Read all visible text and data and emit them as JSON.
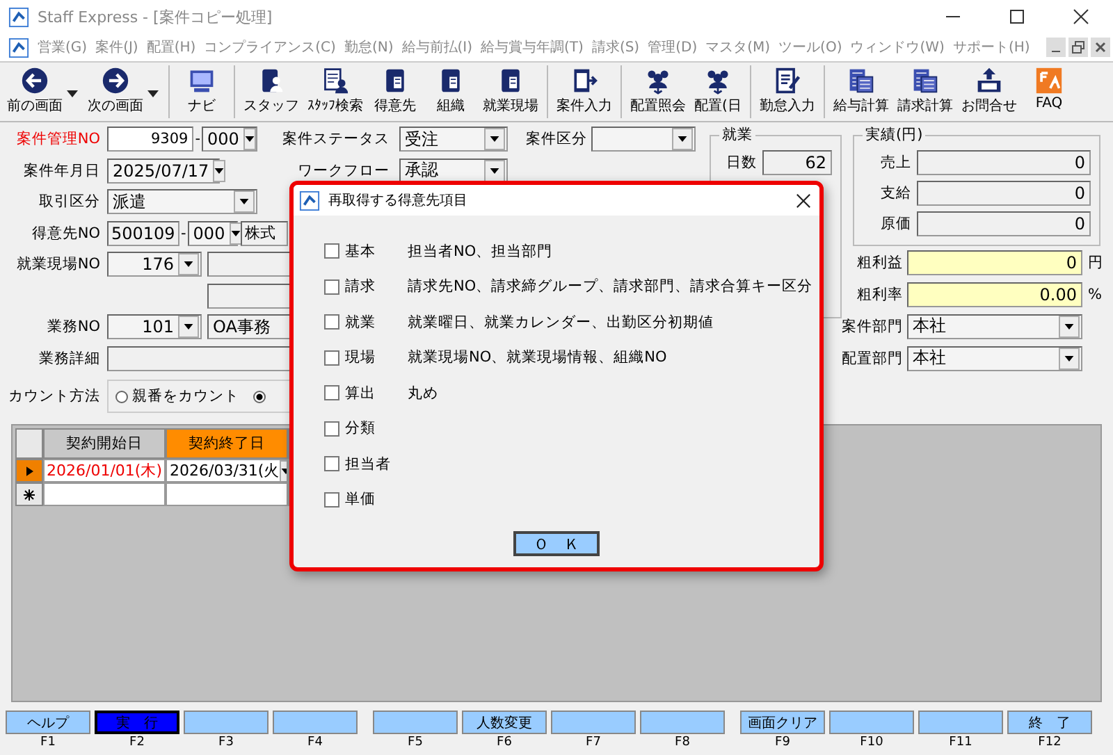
{
  "window": {
    "title": "Staff Express - [案件コピー処理]"
  },
  "menu": [
    "営業(G)",
    "案件(J)",
    "配置(H)",
    "コンプライアンス(C)",
    "勤怠(N)",
    "給与前払(I)",
    "給与賞与年調(T)",
    "請求(S)",
    "管理(D)",
    "マスタ(M)",
    "ツール(O)",
    "ウィンドウ(W)",
    "サポート(H)"
  ],
  "toolbar": [
    {
      "label": "前の画面",
      "kind": "back",
      "dropdown": true,
      "separator_before": false
    },
    {
      "label": "次の画面",
      "kind": "forward",
      "dropdown": true,
      "separator_before": false
    },
    {
      "label": "ナビ",
      "kind": "navi",
      "dropdown": false,
      "separator_before": true
    },
    {
      "label": "スタッフ",
      "kind": "binder-person",
      "dropdown": false,
      "separator_before": true
    },
    {
      "label": "ｽﾀｯﾌ検索",
      "kind": "doc-person",
      "dropdown": false,
      "separator_before": false
    },
    {
      "label": "得意先",
      "kind": "binder",
      "dropdown": false,
      "separator_before": false
    },
    {
      "label": "組織",
      "kind": "binder",
      "dropdown": false,
      "separator_before": false
    },
    {
      "label": "就業現場",
      "kind": "binder",
      "dropdown": false,
      "separator_before": false
    },
    {
      "label": "案件入力",
      "kind": "doc-arrow",
      "dropdown": false,
      "separator_before": true
    },
    {
      "label": "配置照会",
      "kind": "people",
      "dropdown": false,
      "separator_before": true
    },
    {
      "label": "配置(日",
      "kind": "people",
      "dropdown": false,
      "separator_before": false
    },
    {
      "label": "勤怠入力",
      "kind": "doc-pen",
      "dropdown": false,
      "separator_before": true
    },
    {
      "label": "給与計算",
      "kind": "calc",
      "dropdown": false,
      "separator_before": true
    },
    {
      "label": "請求計算",
      "kind": "calc",
      "dropdown": false,
      "separator_before": false
    },
    {
      "label": "お問合せ",
      "kind": "tray",
      "dropdown": false,
      "separator_before": false
    },
    {
      "label": "FAQ",
      "kind": "faq",
      "dropdown": false,
      "separator_before": false
    }
  ],
  "form": {
    "case_no": {
      "label": "案件管理NO",
      "value": "9309",
      "dash": "-",
      "branch": "000"
    },
    "case_status": {
      "label": "案件ステータス",
      "value": "受注"
    },
    "case_type": {
      "label": "案件区分"
    },
    "case_date": {
      "label": "案件年月日",
      "value": "2025/07/17"
    },
    "workflow": {
      "label": "ワークフロー",
      "value": "承認"
    },
    "deal_type": {
      "label": "取引区分",
      "value": "派遣"
    },
    "client": {
      "label": "得意先NO",
      "value": "500109",
      "dash": "-",
      "branch": "000",
      "name": "株式"
    },
    "site": {
      "label": "就業現場NO",
      "value": "176"
    },
    "job": {
      "label": "業務NO",
      "value": "101",
      "name": "OA事務"
    },
    "job_detail": {
      "label": "業務詳細"
    },
    "count_method": {
      "label": "カウント方法",
      "options": [
        {
          "label": "親番をカウント",
          "selected": false
        },
        {
          "selected": true
        }
      ]
    },
    "employment": {
      "title": "就業",
      "rows": [
        {
          "label": "日数",
          "value": "62"
        }
      ]
    },
    "results": {
      "title": "実績(円)",
      "rows": [
        {
          "label": "売上",
          "value": "0"
        },
        {
          "label": "支給",
          "value": "0"
        },
        {
          "label": "原価",
          "value": "0"
        }
      ]
    },
    "gross_profit": {
      "label": "粗利益",
      "value": "0",
      "unit": "円"
    },
    "gross_margin": {
      "label": "粗利率",
      "value": "0.00",
      "unit": "%"
    },
    "case_dept": {
      "label": "案件部門",
      "value": "本社"
    },
    "placement_dept": {
      "label": "配置部門",
      "value": "本社"
    }
  },
  "grid": {
    "columns": [
      {
        "label": "契約開始日",
        "selected": false
      },
      {
        "label": "契約終了日",
        "selected": true
      }
    ],
    "rows": [
      {
        "current": true,
        "cells": [
          {
            "text": "2026/01/01(木)",
            "warning": true
          },
          {
            "text": "2026/03/31(火",
            "warning": false
          }
        ]
      }
    ]
  },
  "dialog": {
    "title": "再取得する得意先項目",
    "items": [
      {
        "label": "基本",
        "description": "担当者NO、担当部門",
        "checked": false
      },
      {
        "label": "請求",
        "description": "請求先NO、請求締グループ、請求部門、請求合算キー区分",
        "checked": false
      },
      {
        "label": "就業",
        "description": "就業曜日、就業カレンダー、出勤区分初期値",
        "checked": false
      },
      {
        "label": "現場",
        "description": "就業現場NO、就業現場情報、組織NO",
        "checked": false
      },
      {
        "label": "算出",
        "description": "丸め",
        "checked": false
      },
      {
        "label": "分類",
        "checked": false
      },
      {
        "label": "担当者",
        "checked": false
      },
      {
        "label": "単価",
        "checked": false
      }
    ],
    "ok": "Ｏ　Ｋ"
  },
  "function_keys": [
    {
      "label": "ヘルプ",
      "key": "F1",
      "selected": false
    },
    {
      "label": "実　行",
      "key": "F2",
      "selected": true
    },
    {
      "key": "F3",
      "selected": false
    },
    {
      "key": "F4",
      "selected": false
    },
    {
      "key": "F5",
      "selected": false
    },
    {
      "label": "人数変更",
      "key": "F6",
      "selected": false
    },
    {
      "key": "F7",
      "selected": false
    },
    {
      "key": "F8",
      "selected": false
    },
    {
      "label": "画面クリア",
      "key": "F9",
      "selected": false
    },
    {
      "key": "F10",
      "selected": false
    },
    {
      "key": "F11",
      "selected": false
    },
    {
      "label": "終　了",
      "key": "F12",
      "selected": false
    }
  ]
}
